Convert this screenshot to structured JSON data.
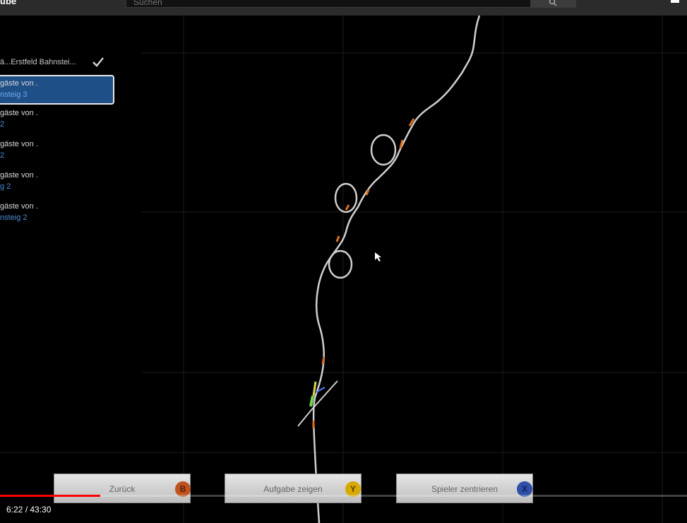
{
  "youtube": {
    "logo_text": "ube",
    "search_placeholder": "Suchen",
    "current_time": "6:22",
    "duration": "43:30",
    "time_display": "6:22 / 43:30",
    "progress_fraction": 0.146
  },
  "tasks": {
    "header": "ä...Erstfeld Bahnstei...",
    "items": [
      {
        "title": "gäste von  .",
        "sub": "nsteig 3",
        "selected": true
      },
      {
        "title": "gäste von  .",
        "sub": "2",
        "selected": false
      },
      {
        "title": "gäste von  .",
        "sub": "2",
        "selected": false
      },
      {
        "title": "gäste von  .",
        "sub": "g 2",
        "selected": false
      },
      {
        "title": "gäste von  .",
        "sub": "nsteig 2",
        "selected": false
      }
    ]
  },
  "buttons": {
    "back": {
      "label": "Zurück",
      "key": "B",
      "color": "#c0521f"
    },
    "show_task": {
      "label": "Aufgabe zeigen",
      "key": "Y",
      "color": "#d8a800"
    },
    "center_player": {
      "label": "Spieler zentrieren",
      "key": "X",
      "color": "#2f4fa8"
    }
  },
  "colors": {
    "track": "#cfcfcf",
    "selected_task": "#1f4f87",
    "progress": "#ff0000"
  }
}
